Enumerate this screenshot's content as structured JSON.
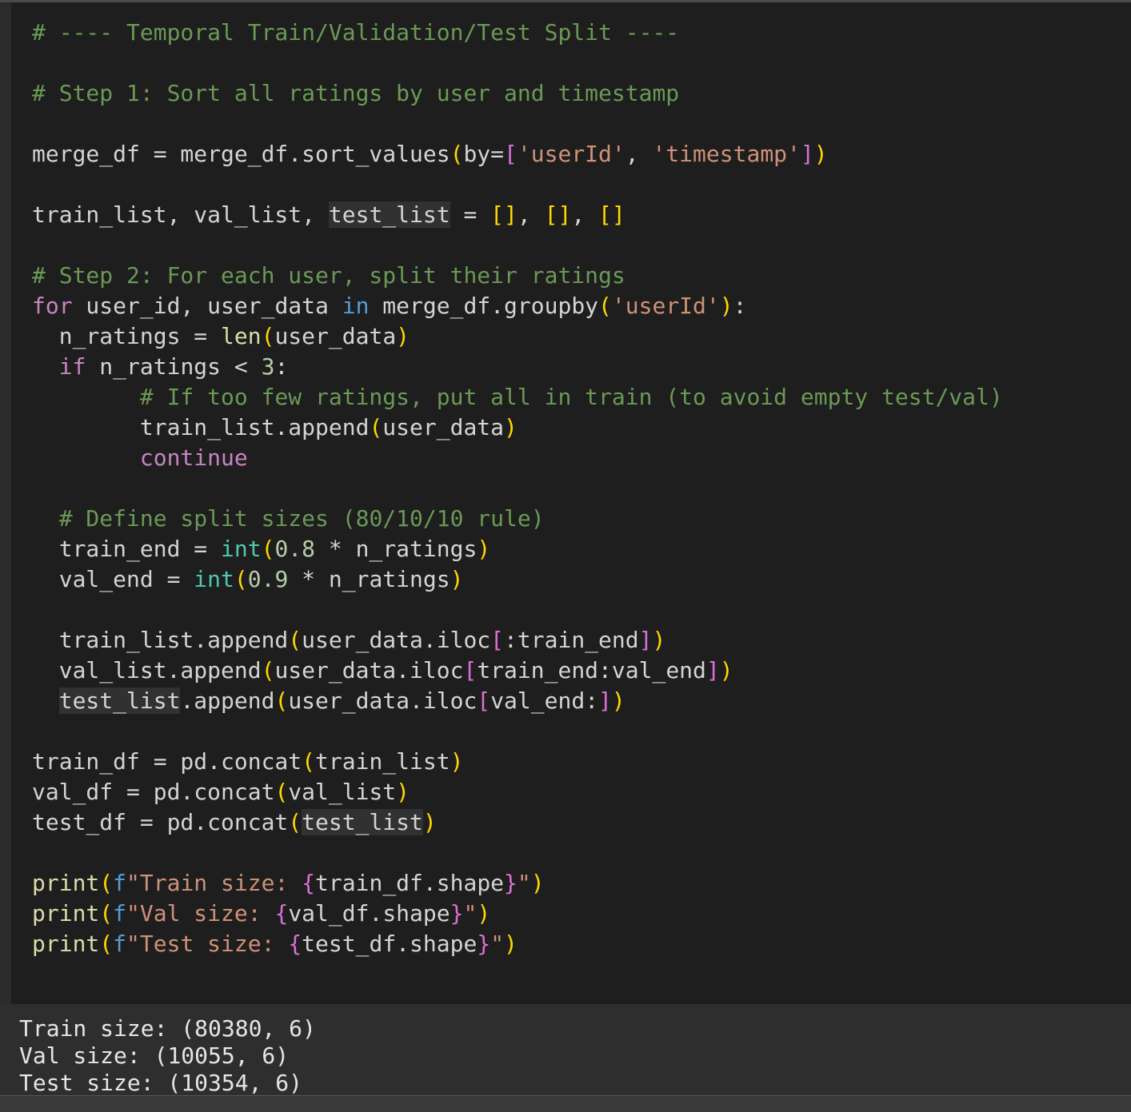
{
  "code_lines": [
    [
      [
        "cm",
        "# ---- Temporal Train/Validation/Test Split ----"
      ]
    ],
    [],
    [
      [
        "cm",
        "# Step 1: Sort all ratings by user and timestamp"
      ]
    ],
    [],
    [
      [
        "",
        "merge_df = merge_df.sort_values"
      ],
      [
        "p1",
        "("
      ],
      [
        "",
        "by="
      ],
      [
        "p2",
        "["
      ],
      [
        "st",
        "'userId'"
      ],
      [
        "",
        ", "
      ],
      [
        "st",
        "'timestamp'"
      ],
      [
        "p2",
        "]"
      ],
      [
        "p1",
        ")"
      ]
    ],
    [],
    [
      [
        "",
        "train_list, val_list, "
      ],
      [
        "hl",
        "test_list"
      ],
      [
        "",
        " = "
      ],
      [
        "p1",
        "[]"
      ],
      [
        "",
        ", "
      ],
      [
        "p1",
        "[]"
      ],
      [
        "",
        ", "
      ],
      [
        "p1",
        "[]"
      ]
    ],
    [],
    [
      [
        "cm",
        "# Step 2: For each user, split their ratings"
      ]
    ],
    [
      [
        "kw",
        "for"
      ],
      [
        "",
        " user_id, user_data "
      ],
      [
        "kw2",
        "in"
      ],
      [
        "",
        " merge_df.groupby"
      ],
      [
        "p1",
        "("
      ],
      [
        "st",
        "'userId'"
      ],
      [
        "p1",
        ")"
      ],
      [
        "",
        ":"
      ]
    ],
    [
      [
        "",
        "  n_ratings = "
      ],
      [
        "bi",
        "len"
      ],
      [
        "p1",
        "("
      ],
      [
        "",
        "user_data"
      ],
      [
        "p1",
        ")"
      ]
    ],
    [
      [
        "",
        "  "
      ],
      [
        "kw",
        "if"
      ],
      [
        "",
        " n_ratings < "
      ],
      [
        "nu",
        "3"
      ],
      [
        "",
        ":"
      ]
    ],
    [
      [
        "",
        "        "
      ],
      [
        "cm",
        "# If too few ratings, put all in train (to avoid empty test/val)"
      ]
    ],
    [
      [
        "",
        "        train_list.append"
      ],
      [
        "p1",
        "("
      ],
      [
        "",
        "user_data"
      ],
      [
        "p1",
        ")"
      ]
    ],
    [
      [
        "",
        "        "
      ],
      [
        "kw",
        "continue"
      ]
    ],
    [],
    [
      [
        "",
        "  "
      ],
      [
        "cm",
        "# Define split sizes (80/10/10 rule)"
      ]
    ],
    [
      [
        "",
        "  train_end = "
      ],
      [
        "ty",
        "int"
      ],
      [
        "p1",
        "("
      ],
      [
        "nu",
        "0.8"
      ],
      [
        "",
        " * n_ratings"
      ],
      [
        "p1",
        ")"
      ]
    ],
    [
      [
        "",
        "  val_end = "
      ],
      [
        "ty",
        "int"
      ],
      [
        "p1",
        "("
      ],
      [
        "nu",
        "0.9"
      ],
      [
        "",
        " * n_ratings"
      ],
      [
        "p1",
        ")"
      ]
    ],
    [],
    [
      [
        "",
        "  train_list.append"
      ],
      [
        "p1",
        "("
      ],
      [
        "",
        "user_data.iloc"
      ],
      [
        "p2",
        "["
      ],
      [
        "",
        ":train_end"
      ],
      [
        "p2",
        "]"
      ],
      [
        "p1",
        ")"
      ]
    ],
    [
      [
        "",
        "  val_list.append"
      ],
      [
        "p1",
        "("
      ],
      [
        "",
        "user_data.iloc"
      ],
      [
        "p2",
        "["
      ],
      [
        "",
        "train_end:val_end"
      ],
      [
        "p2",
        "]"
      ],
      [
        "p1",
        ")"
      ]
    ],
    [
      [
        "",
        "  "
      ],
      [
        "hl",
        "test_list"
      ],
      [
        "",
        ".append"
      ],
      [
        "p1",
        "("
      ],
      [
        "",
        "user_data.iloc"
      ],
      [
        "p2",
        "["
      ],
      [
        "",
        "val_end:"
      ],
      [
        "p2",
        "]"
      ],
      [
        "p1",
        ")"
      ]
    ],
    [],
    [
      [
        "",
        "train_df = pd.concat"
      ],
      [
        "p1",
        "("
      ],
      [
        "",
        "train_list"
      ],
      [
        "p1",
        ")"
      ]
    ],
    [
      [
        "",
        "val_df = pd.concat"
      ],
      [
        "p1",
        "("
      ],
      [
        "",
        "val_list"
      ],
      [
        "p1",
        ")"
      ]
    ],
    [
      [
        "",
        "test_df = pd.concat"
      ],
      [
        "p1",
        "("
      ],
      [
        "hl",
        "test_list"
      ],
      [
        "p1",
        ")"
      ]
    ],
    [],
    [
      [
        "bi",
        "print"
      ],
      [
        "p1",
        "("
      ],
      [
        "kw2",
        "f"
      ],
      [
        "st",
        "\"Train size: "
      ],
      [
        "p2",
        "{"
      ],
      [
        "",
        "train_df.shape"
      ],
      [
        "p2",
        "}"
      ],
      [
        "st",
        "\""
      ],
      [
        "p1",
        ")"
      ]
    ],
    [
      [
        "bi",
        "print"
      ],
      [
        "p1",
        "("
      ],
      [
        "kw2",
        "f"
      ],
      [
        "st",
        "\"Val size: "
      ],
      [
        "p2",
        "{"
      ],
      [
        "",
        "val_df.shape"
      ],
      [
        "p2",
        "}"
      ],
      [
        "st",
        "\""
      ],
      [
        "p1",
        ")"
      ]
    ],
    [
      [
        "bi",
        "print"
      ],
      [
        "p1",
        "("
      ],
      [
        "kw2",
        "f"
      ],
      [
        "st",
        "\"Test size: "
      ],
      [
        "p2",
        "{"
      ],
      [
        "",
        "test_df.shape"
      ],
      [
        "p2",
        "}"
      ],
      [
        "st",
        "\""
      ],
      [
        "p1",
        ")"
      ]
    ]
  ],
  "output": {
    "lines": [
      "Train size: (80380, 6)",
      "Val size: (10055, 6)",
      "Test size: (10354, 6)"
    ]
  },
  "colors": {
    "background": "#1e1e1e",
    "comment": "#6a9955",
    "keyword": "#c586c0",
    "string": "#ce9178",
    "number": "#b5cea8",
    "builtin_type": "#4ec9b0",
    "bracket_level1": "#ffd700",
    "bracket_level2": "#da70d6",
    "output_background": "#2e2e2e"
  }
}
